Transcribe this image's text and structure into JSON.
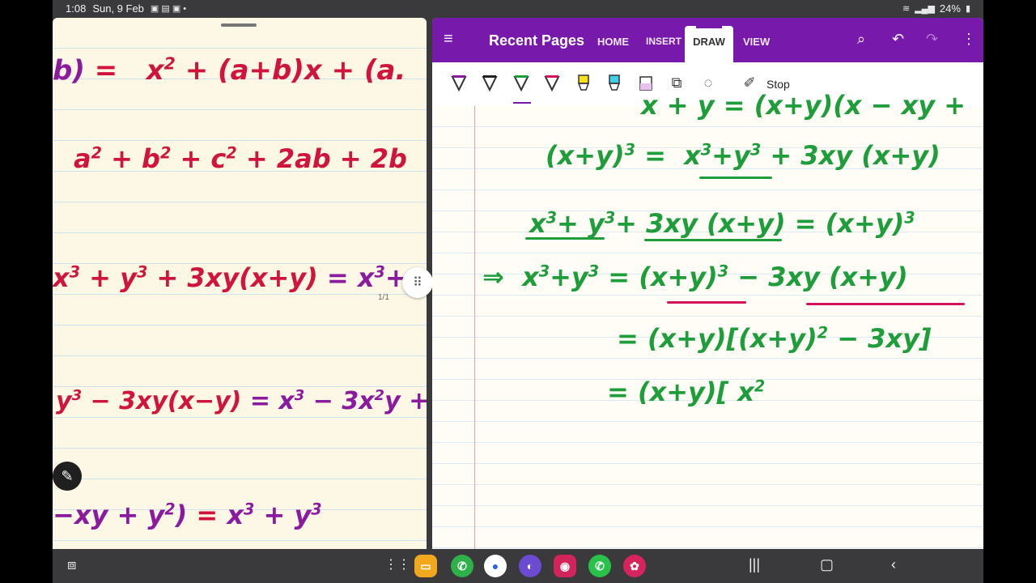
{
  "status": {
    "time": "1:08",
    "date": "Sun, 9 Feb",
    "battery": "24%"
  },
  "left_page": {
    "page_indicator": "1/1",
    "lines": [
      {
        "text": "b) =   x² + (a+b)x + (a."
      },
      {
        "text": "a² + b² + c² + 2ab + 2b"
      },
      {
        "text": "x³ + y³ + 3xy(x+y) = x³+"
      },
      {
        "text": "y³ − 3xy(x−y) = x³ − 3x²y +"
      },
      {
        "text": "−xy + y²) = x³ + y³"
      }
    ]
  },
  "onenote": {
    "title": "Recent Pages",
    "tabs": [
      "HOME",
      "INSERT",
      "DRAW",
      "VIEW"
    ],
    "active_tab": "DRAW",
    "stop_label": "Stop",
    "accent": "#7719aa"
  },
  "note_lines": [
    {
      "text": "x + y = (x+y)(x−xy+"
    },
    {
      "text": "(x+y)³ =  x³+y³ + 3xy(x+y)"
    },
    {
      "text": "x³+ y³+ 3xy(x+y) = (x+y)³"
    },
    {
      "text": "⇒  x³+y³ = (x+y)³ − 3xy(x+y)"
    },
    {
      "text": "= (x+y)[(x+y)² − 3xy]"
    },
    {
      "text": "= (x+y)[ x²"
    }
  ],
  "nav": {
    "apps": [
      "files",
      "phone",
      "messages",
      "internet",
      "camera",
      "whatsapp",
      "gallery"
    ]
  }
}
